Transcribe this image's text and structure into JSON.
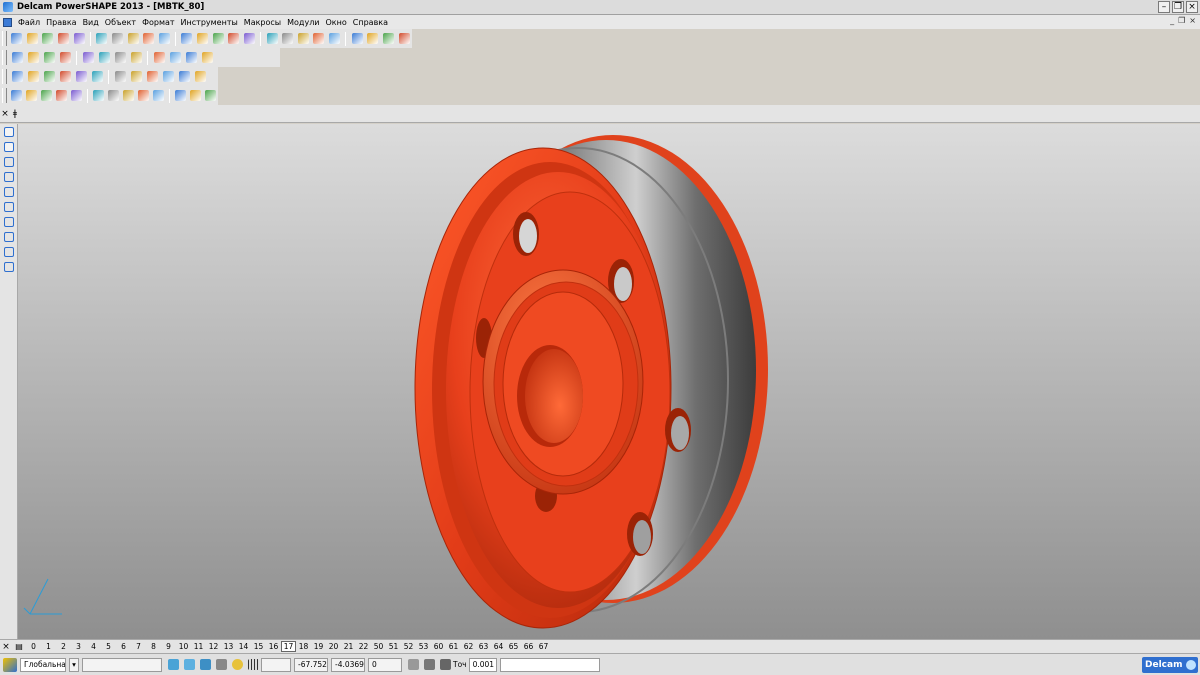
{
  "window": {
    "title": "Delcam PowerSHAPE 2013 - [MBTK_80]"
  },
  "menu": [
    "Файл",
    "Правка",
    "Вид",
    "Объект",
    "Формат",
    "Инструменты",
    "Макросы",
    "Модули",
    "Окно",
    "Справка"
  ],
  "levels": {
    "items": [
      "0",
      "1",
      "2",
      "3",
      "4",
      "5",
      "6",
      "7",
      "8",
      "9",
      "10",
      "11",
      "12",
      "13",
      "14",
      "15",
      "16",
      "17",
      "18",
      "19",
      "20",
      "21",
      "22",
      "50",
      "51",
      "52",
      "53",
      "60",
      "61",
      "62",
      "63",
      "64",
      "65",
      "66",
      "67"
    ],
    "active": "17"
  },
  "status": {
    "workplane": "Глобальна",
    "x": "-67.752",
    "y": "-4.0369",
    "z": "0",
    "tolerance_label": "Точ",
    "tolerance_value": "0.001",
    "logo": "Delcam"
  },
  "colors": {
    "model": "#e8401c",
    "rim": "#8a8a8a",
    "accent": "#2f6fcf"
  },
  "icons": {
    "toolbar1": [
      "select-arrow-icon",
      "new-file-icon",
      "open-file-icon",
      "print-icon",
      "save-icon",
      "save-as-icon",
      "cut-icon",
      "copy-icon",
      "paste-icon",
      "delete-icon",
      "find-icon",
      "undo-icon",
      "redo-icon",
      "pen-icon",
      "zoom-model-icon",
      "workplane-icon",
      "cursor-select-icon",
      "circle-select-icon",
      "curve-icon",
      "text-icon",
      "shade-icon",
      "surface-icon",
      "solid-icon",
      "tools-icon"
    ],
    "toolbar2": [
      "view-iso1-icon",
      "view-iso2-icon",
      "view-iso3-icon",
      "view-top-icon",
      "view-front-icon",
      "zoom-in-icon",
      "zoom-out-icon",
      "sphere-view-icon",
      "shaded-view-icon",
      "wireframe-view-icon",
      "lightbulb-icon",
      "hand-pan-icon"
    ],
    "toolbar3": [
      "pin-icon",
      "layers-icon",
      "solid-box-icon",
      "colour-ball-icon",
      "red-ball-icon",
      "render-icon",
      "triangle-icon",
      "cube-icon",
      "calculator-icon",
      "analysis-icon",
      "preview-icon",
      "exit-icon"
    ],
    "toolbar4": [
      "pin-icon",
      "cylinder-icon",
      "axes-icon",
      "extrude-icon",
      "revolve-icon",
      "primitive-icon",
      "boolean-icon",
      "box-icon",
      "feature-icon",
      "grid-icon",
      "shell-icon",
      "fillet-icon",
      "draft-icon"
    ],
    "left": [
      "arrow-select-icon",
      "multi-select-icon",
      "line-icon",
      "polyline-icon",
      "rectangle-icon",
      "circle-icon",
      "solid-icon",
      "dimension-icon",
      "arc-icon",
      "axis-icon"
    ]
  }
}
